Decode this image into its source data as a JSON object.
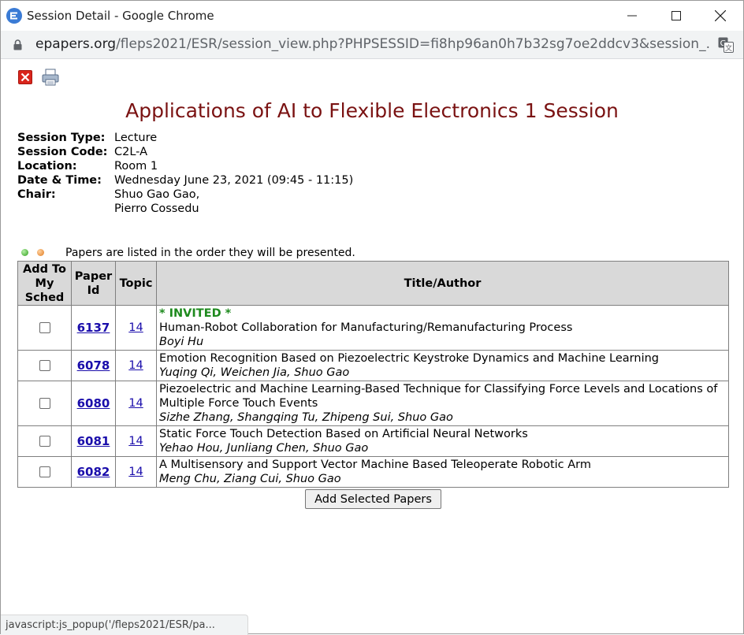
{
  "window": {
    "title": "Session Detail - Google Chrome",
    "icon": "app-logo-icon"
  },
  "address_bar": {
    "host": "epapers.org",
    "path": "/fleps2021/ESR/session_view.php?PHPSESSID=fi8hp96an0h7b32sg7oe2ddcv3&session_..."
  },
  "toolbar": {
    "close_icon": "close-icon",
    "print_icon": "print-icon"
  },
  "session": {
    "title": "Applications of AI to Flexible Electronics 1 Session",
    "fields": [
      {
        "label": "Session Type:",
        "value": "Lecture"
      },
      {
        "label": "Session Code:",
        "value": "C2L-A"
      },
      {
        "label": "Location:",
        "value": "Room 1"
      },
      {
        "label": "Date & Time:",
        "value": "Wednesday June 23, 2021 (09:45 - 11:15)"
      },
      {
        "label": "Chair:",
        "value": "Shuo Gao Gao,"
      },
      {
        "label": "",
        "value": "Pierro Cossedu"
      }
    ]
  },
  "papers_note": "Papers are listed in the order they will be presented.",
  "table": {
    "headers": {
      "add_line1": "Add To",
      "add_line2": "My",
      "add_line3": "Sched",
      "paper_line1": "Paper",
      "paper_line2": "Id",
      "topic": "Topic",
      "title_author": "Title/Author"
    },
    "rows": [
      {
        "id": "6137",
        "topic": "14",
        "tag": "* INVITED *",
        "title": "Human-Robot Collaboration for Manufacturing/Remanufacturing Process",
        "authors": "Boyi Hu"
      },
      {
        "id": "6078",
        "topic": "14",
        "tag": "",
        "title": "Emotion Recognition Based on Piezoelectric Keystroke Dynamics and Machine Learning",
        "authors": "Yuqing Qi, Weichen Jia, Shuo Gao"
      },
      {
        "id": "6080",
        "topic": "14",
        "tag": "",
        "title": "Piezoelectric and Machine Learning-Based Technique for Classifying Force Levels and Locations of Multiple Force Touch Events",
        "authors": "Sizhe Zhang, Shangqing Tu, Zhipeng Sui, Shuo Gao"
      },
      {
        "id": "6081",
        "topic": "14",
        "tag": "",
        "title": "Static Force Touch Detection Based on Artificial Neural Networks",
        "authors": "Yehao Hou, Junliang Chen, Shuo Gao"
      },
      {
        "id": "6082",
        "topic": "14",
        "tag": "",
        "title": "A Multisensory and Support Vector Machine Based Teleoperate Robotic Arm",
        "authors": "Meng Chu, Ziang Cui, Shuo Gao"
      }
    ]
  },
  "add_button_label": "Add Selected Papers",
  "status_text": "javascript:js_popup('/fleps2021/ESR/pa...",
  "colors": {
    "title": "#7a1212",
    "link": "#1a0dab",
    "invited": "#1e8a1e",
    "header_bg": "#d9d9d9"
  }
}
